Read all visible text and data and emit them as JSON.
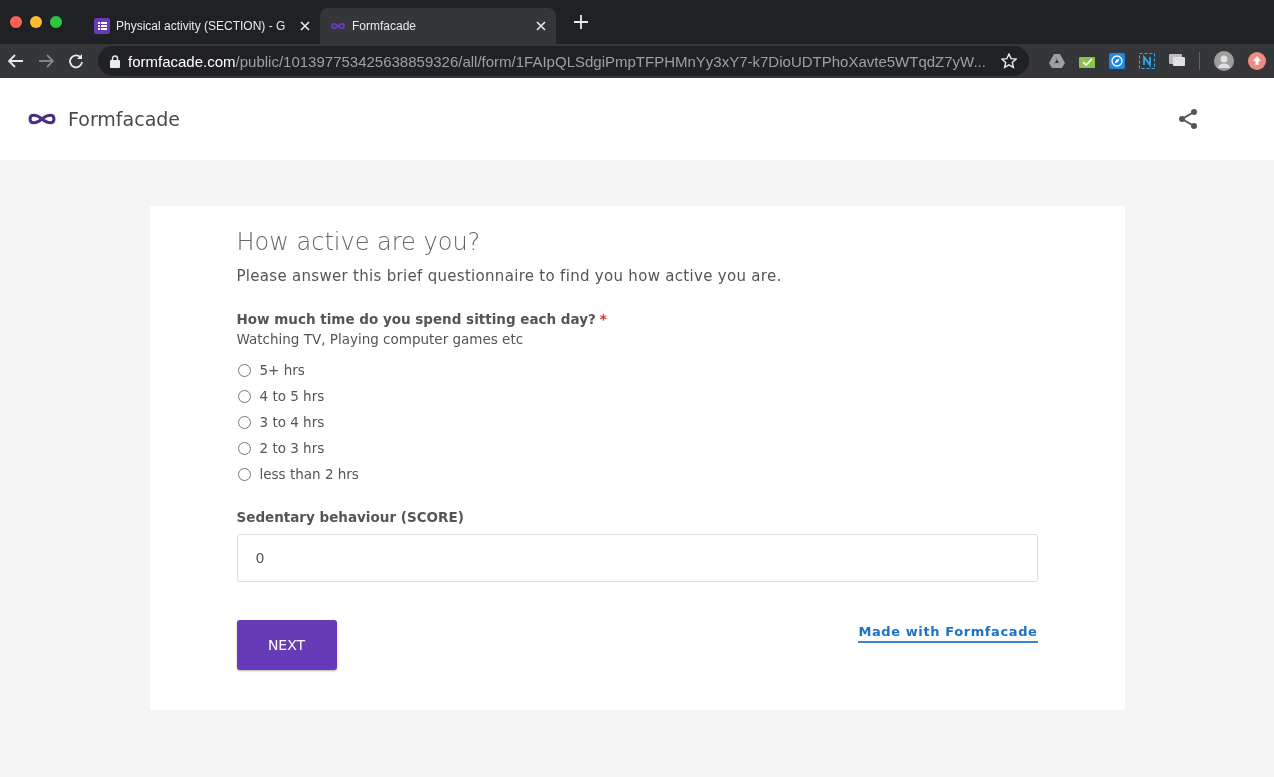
{
  "browser": {
    "tabs": [
      {
        "title": "Physical activity (SECTION) - G",
        "selected": false
      },
      {
        "title": "Formfacade",
        "selected": true
      }
    ],
    "url": {
      "host": "formfacade.com",
      "path": "/public/101397753425638859326/all/form/1FAIpQLSdgiPmpTFPHMnYy3xY7-k7DioUDTPhoXavte5WTqdZ7yW..."
    }
  },
  "header": {
    "brand": "Formfacade"
  },
  "form": {
    "title": "How active are you?",
    "description": "Please answer this brief questionnaire to find you how active you are.",
    "question": {
      "label": "How much time do you spend sitting each day?",
      "required": true,
      "required_mark": "*",
      "help": "Watching TV, Playing computer games etc",
      "options": [
        {
          "label": "5+ hrs",
          "selected": false
        },
        {
          "label": "4 to 5 hrs",
          "selected": false
        },
        {
          "label": "3 to 4 hrs",
          "selected": false
        },
        {
          "label": "2 to 3 hrs",
          "selected": false
        },
        {
          "label": "less than 2 hrs",
          "selected": false
        }
      ]
    },
    "score": {
      "label": "Sedentary behaviour (SCORE)",
      "value": "0"
    },
    "next_button": "NEXT",
    "footer_link": "Made with Formfacade"
  }
}
